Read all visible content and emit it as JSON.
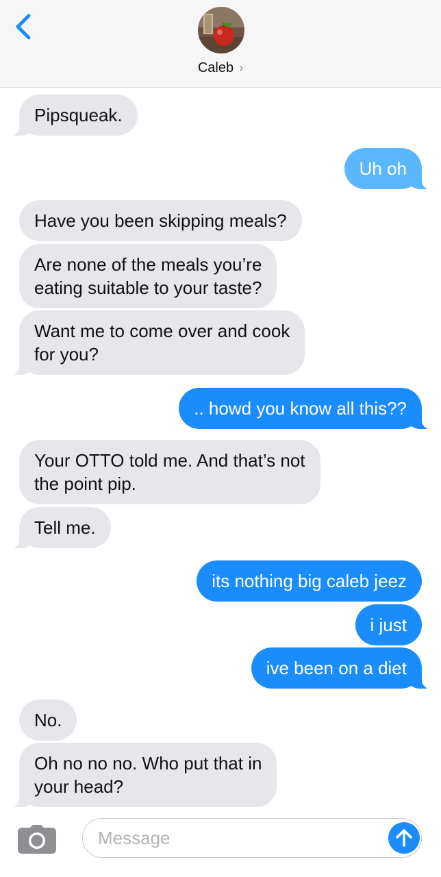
{
  "header": {
    "contact_name": "Caleb",
    "chevron": "›",
    "back_icon": "chevron-left-icon",
    "avatar_description": "contact-photo"
  },
  "messages": [
    {
      "from": "contact",
      "text": "Pipsqueak."
    },
    {
      "from": "me",
      "text": "Uh oh"
    },
    {
      "from": "contact",
      "text": "Have you been skipping meals?"
    },
    {
      "from": "contact",
      "text": "Are none of the meals you’re\neating suitable to your taste?"
    },
    {
      "from": "contact",
      "text": "Want me to come over and cook\nfor you?"
    },
    {
      "from": "me",
      "text": ".. howd you know all this??"
    },
    {
      "from": "contact",
      "text": "Your OTTO told me. And that’s not\nthe point pip."
    },
    {
      "from": "contact",
      "text": "Tell me."
    },
    {
      "from": "me",
      "text": "its nothing big caleb jeez"
    },
    {
      "from": "me",
      "text": "i just"
    },
    {
      "from": "me",
      "text": "ive been on a diet"
    },
    {
      "from": "contact",
      "text": "No."
    },
    {
      "from": "contact",
      "text": "Oh no no no. Who put that in\nyour head?"
    }
  ],
  "composer": {
    "placeholder": "Message",
    "camera_icon": "camera-icon",
    "send_icon": "arrow-up-icon"
  },
  "colors": {
    "incoming_bubble": "#e6e6eb",
    "outgoing_bubble": "#1a8cfc",
    "outgoing_bubble_light": "#5ab7fc",
    "accent": "#1a8cfc"
  }
}
